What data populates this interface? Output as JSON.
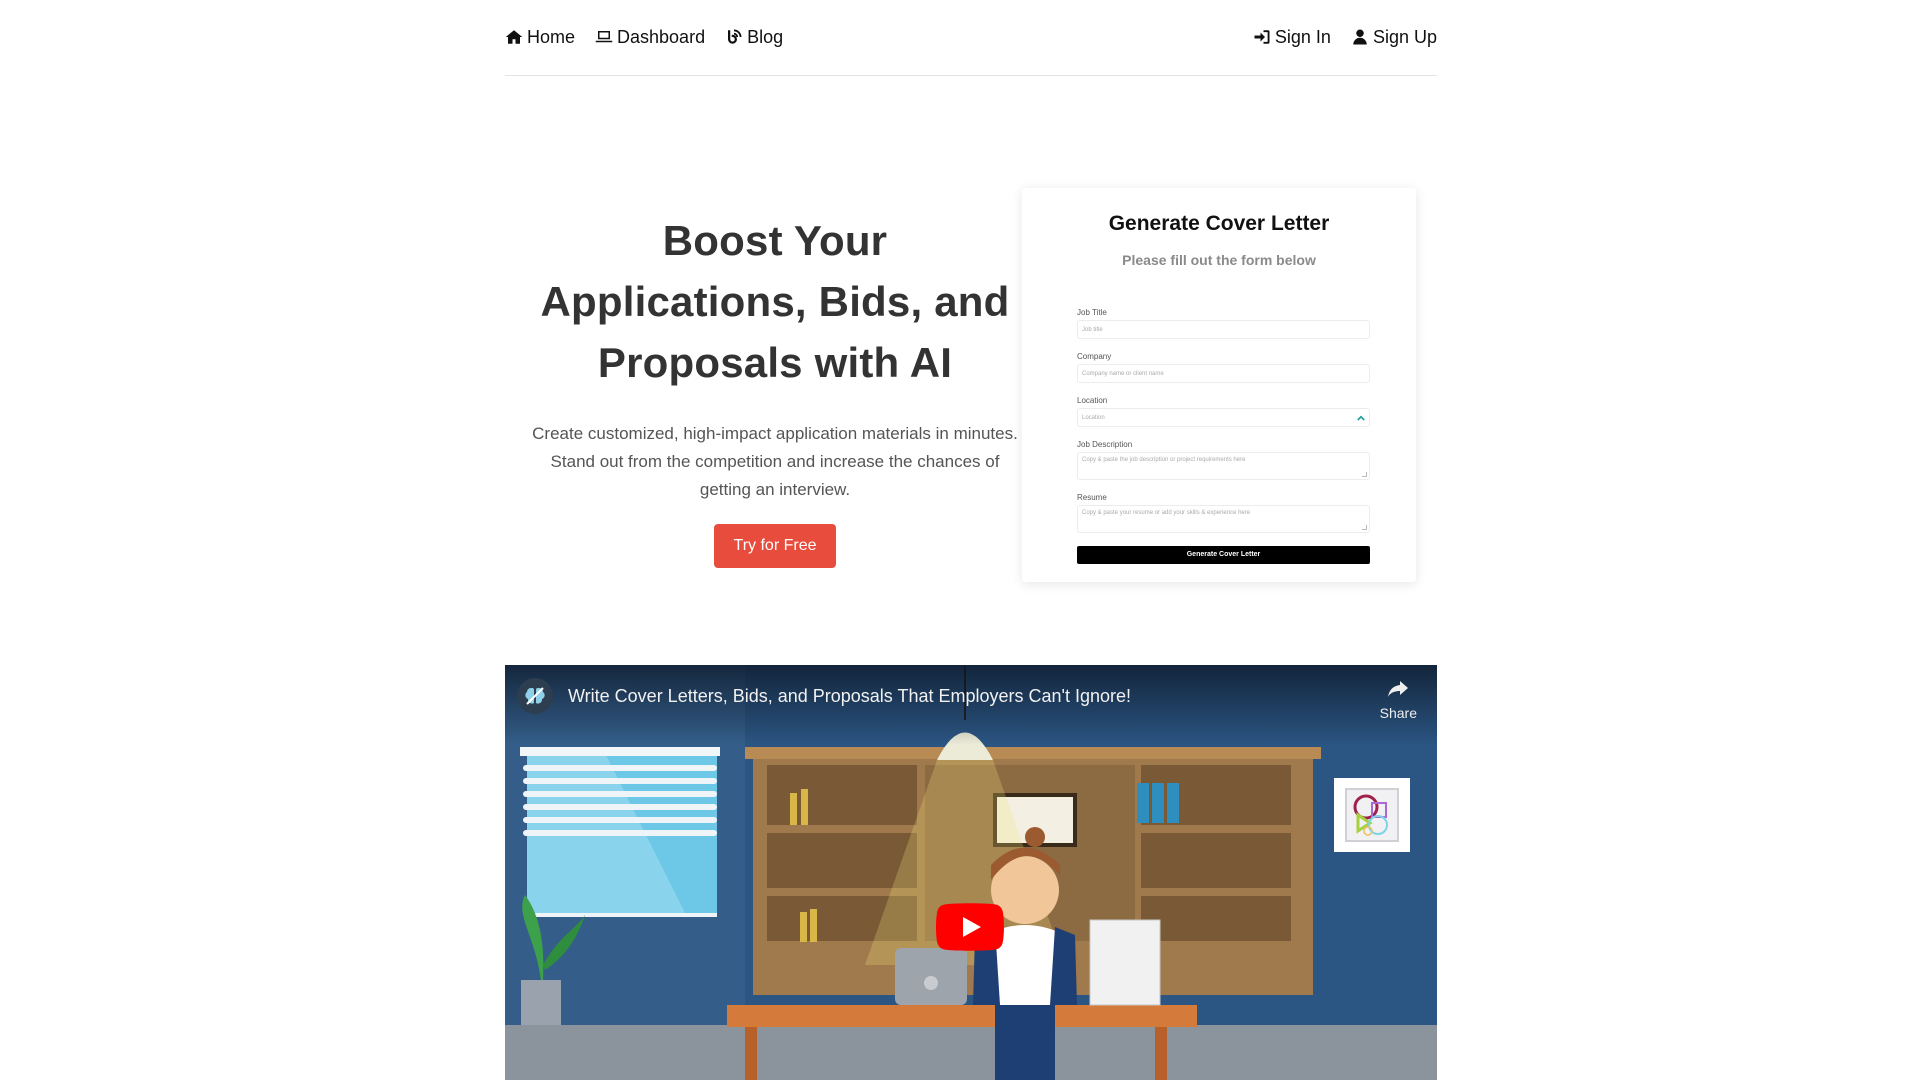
{
  "nav": {
    "left": [
      {
        "label": "Home",
        "icon": "home-icon"
      },
      {
        "label": "Dashboard",
        "icon": "laptop-icon"
      },
      {
        "label": "Blog",
        "icon": "blog-feed-icon"
      }
    ],
    "right": [
      {
        "label": "Sign In",
        "icon": "sign-in-icon"
      },
      {
        "label": "Sign Up",
        "icon": "user-icon"
      }
    ]
  },
  "hero": {
    "title_lines": [
      "Boost Your",
      "Applications, Bids, and",
      "Proposals with AI"
    ],
    "description": "Create customized, high-impact application materials in minutes. Stand out from the competition and increase the chances of getting an interview.",
    "cta_label": "Try for Free",
    "cta_color": "#e74c3c"
  },
  "form": {
    "title": "Generate Cover Letter",
    "subtitle": "Please fill out the form below",
    "fields": [
      {
        "label": "Job Title",
        "placeholder": "Job title",
        "type": "input"
      },
      {
        "label": "Company",
        "placeholder": "Company name or client name",
        "type": "input"
      },
      {
        "label": "Location",
        "placeholder": "Location",
        "type": "select"
      },
      {
        "label": "Job Description",
        "placeholder": "Copy & paste the job description or project requirements here",
        "type": "textarea"
      },
      {
        "label": "Resume",
        "placeholder": "Copy & paste your resume or add your skills & experience here",
        "type": "textarea"
      }
    ],
    "submit_label": "Generate Cover Letter"
  },
  "video": {
    "title": "Write Cover Letters, Bids, and Proposals That Employers Can't Ignore!",
    "share_label": "Share",
    "play_color": "#ff0000"
  }
}
